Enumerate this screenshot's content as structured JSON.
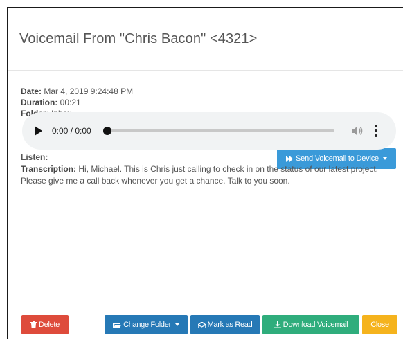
{
  "header": {
    "title": "Voicemail From \"Chris Bacon\" <4321>"
  },
  "meta": {
    "date_label": "Date:",
    "date_value": "Mar 4, 2019 9:24:48 PM",
    "duration_label": "Duration:",
    "duration_value": "00:21",
    "folder_label": "Folder:",
    "folder_value": "Inbox"
  },
  "listen": {
    "label": "Listen:",
    "send_button": "Send Voicemail to Device"
  },
  "player": {
    "time": "0:00 / 0:00",
    "progress": 0
  },
  "transcription": {
    "label": "Transcription:",
    "text": "Hi, Michael. This is Chris just calling to check in on the status of our latest project. Please give me a call back whenever you get a chance. Talk to you soon."
  },
  "footer": {
    "delete": "Delete",
    "change_folder": "Change Folder",
    "mark_read": "Mark as Read",
    "download": "Download Voicemail",
    "close": "Close"
  },
  "colors": {
    "send": "#3a9ad9",
    "delete": "#de4b3b",
    "primary": "#2679b6",
    "download": "#2fad7c",
    "close": "#f5b31d"
  },
  "icons": {
    "send": "fast-forward-icon",
    "delete": "trash-icon",
    "folder": "folder-icon",
    "read": "envelope-open-icon",
    "download": "download-icon"
  }
}
